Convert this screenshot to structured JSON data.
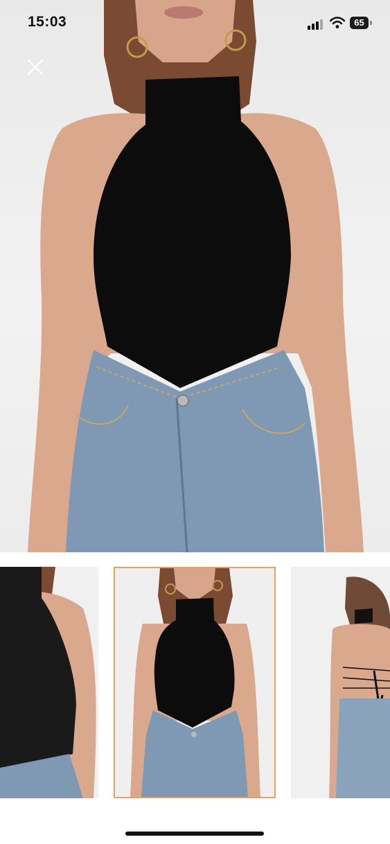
{
  "status_bar": {
    "time": "15:03",
    "battery_level": "65",
    "signal_bars": 3,
    "wifi": true
  },
  "viewer": {
    "close_icon": "close-icon",
    "selected_thumbnail_index": 1,
    "thumbnail_count": 3,
    "thumbnails": [
      {
        "view": "side"
      },
      {
        "view": "front"
      },
      {
        "view": "back"
      }
    ]
  },
  "colors": {
    "selected_border": "#e4a25f",
    "top_black": "#0c0c0c",
    "denim": "#7f98b4",
    "background": "#ffffff"
  }
}
